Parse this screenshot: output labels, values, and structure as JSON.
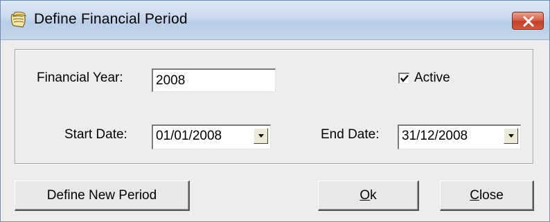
{
  "window": {
    "title": "Define Financial Period",
    "icon": "notepad-app-icon",
    "close_icon": "close-icon",
    "close_color": "#d0503a"
  },
  "form": {
    "financial_year_label": "Financial Year:",
    "financial_year_value": "2008",
    "active_label": "Active",
    "active_checked": true,
    "start_date_label": "Start Date:",
    "start_date_value": "01/01/2008",
    "end_date_label": "End Date:",
    "end_date_value": "31/12/2008"
  },
  "buttons": {
    "define_new_period": "Define New Period",
    "ok_mnemonic": "O",
    "ok_rest": "k",
    "close_mnemonic": "C",
    "close_rest": "lose"
  }
}
